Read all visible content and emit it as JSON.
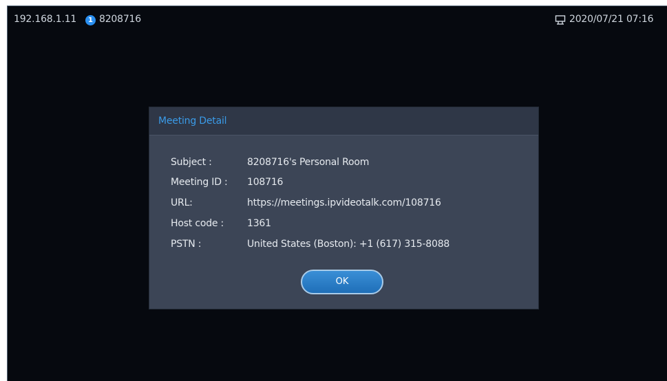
{
  "statusbar": {
    "ip": "192.168.1.11",
    "account_icon": "account-1-icon",
    "account_glyph": "1",
    "account": "8208716",
    "meeting_icon": "meeting-icon",
    "datetime": "2020/07/21  07:16"
  },
  "dialog": {
    "title": "Meeting Detail",
    "rows": [
      {
        "label": "Subject :",
        "value": "8208716's Personal Room"
      },
      {
        "label": "Meeting ID :",
        "value": "108716"
      },
      {
        "label": "URL:",
        "value": "https://meetings.ipvideotalk.com/108716"
      },
      {
        "label": "Host code :",
        "value": "1361"
      },
      {
        "label": "PSTN :",
        "value": "United States (Boston): +1 (617) 315-8088"
      }
    ],
    "ok_label": "OK"
  },
  "colors": {
    "screen_bg": "#06090f",
    "dialog_bg": "#3c4556",
    "dialog_header_bg": "#2f3747",
    "title_blue": "#3a9be8",
    "button_blue": "#2a7fc8"
  }
}
